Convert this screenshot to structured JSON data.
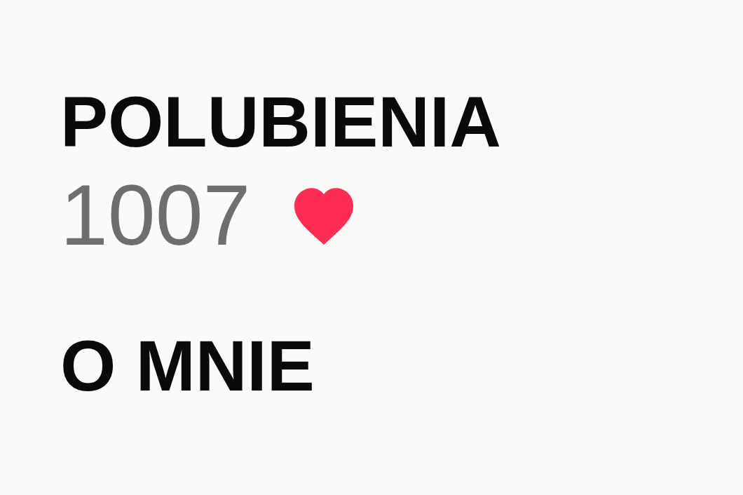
{
  "sections": [
    {
      "heading": "POLUBIENIA",
      "value": "1007",
      "liked": true
    },
    {
      "heading": "O MNIE"
    }
  ]
}
